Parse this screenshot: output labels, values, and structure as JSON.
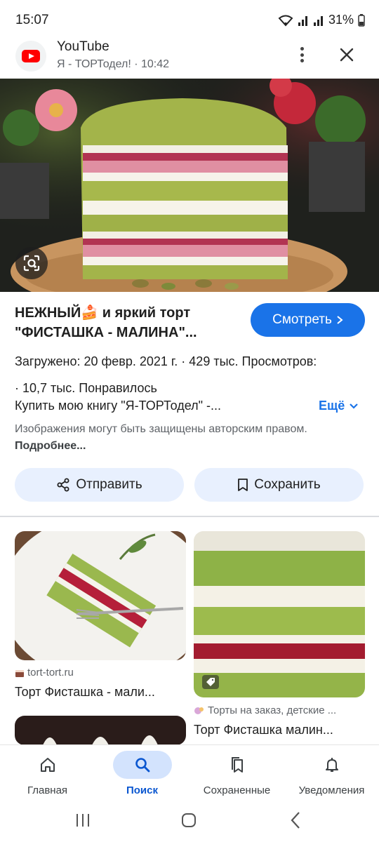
{
  "status": {
    "time": "15:07",
    "battery": "31%"
  },
  "source": {
    "name": "YouTube",
    "subtitle": "Я - ТОРТодел! · 10:42"
  },
  "result": {
    "title_line1": "НЕЖНЫЙ🍰 и яркий торт",
    "title_line2": "\"ФИСТАШКА - МАЛИНА\"...",
    "watch_label": "Смотреть",
    "meta_line1": "Загружено: 20 февр. 2021 г.  ·  429 тыс. Просмотров:",
    "meta_line2": "· 10,7 тыс. Понравилось",
    "description": "Купить мою книгу \"Я-ТОРТодел\" -...",
    "more_label": "Ещё",
    "copyright_text": "Изображения могут быть защищены авторским правом.",
    "copyright_link": "Подробнее..."
  },
  "actions": {
    "send_label": "Отправить",
    "save_label": "Сохранить"
  },
  "cards": [
    {
      "source": "tort-tort.ru",
      "title": "Торт Фисташка - мали..."
    },
    {
      "source": "Торты на заказ, детские ...",
      "title": "Торт Фисташка малин..."
    }
  ],
  "nav": {
    "items": [
      {
        "label": "Главная",
        "icon": "home-icon"
      },
      {
        "label": "Поиск",
        "icon": "search-icon"
      },
      {
        "label": "Сохраненные",
        "icon": "bookmarks-icon"
      },
      {
        "label": "Уведомления",
        "icon": "bell-icon"
      }
    ],
    "active_index": 1
  },
  "colors": {
    "accent": "#1a73e8",
    "chip_bg": "#e8f0fe",
    "nav_active": "#d3e3fd"
  }
}
